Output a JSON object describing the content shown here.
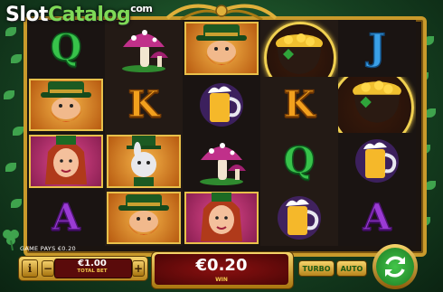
{
  "watermark": {
    "brand_a": "Slot",
    "brand_b": "Catalog",
    "suffix": "com"
  },
  "reels": [
    [
      "Q",
      "leprechaun",
      "elf-woman",
      "A"
    ],
    [
      "mushroom",
      "K",
      "rabbit",
      "leprechaun"
    ],
    [
      "leprechaun",
      "beer",
      "mushroom",
      "elf-woman"
    ],
    [
      "pot-of-gold",
      "K",
      "Q",
      "beer"
    ],
    [
      "J",
      "pot-of-gold",
      "beer",
      "A"
    ]
  ],
  "letters": {
    "Q": "Q",
    "K": "K",
    "J": "J",
    "A": "A"
  },
  "colors": {
    "Q": "#37c24a",
    "K": "#f2a01d",
    "J": "#3aa0e8",
    "A": "#9a3bd4",
    "frame": "#c99a2b",
    "win_bg": "#6a0a0a",
    "spin": "#2ea336"
  },
  "controls": {
    "info_label": "i",
    "minus_label": "−",
    "plus_label": "+",
    "game_pays": "GAME PAYS €0.20",
    "bet_value": "€1.00",
    "bet_label": "TOTAL BET",
    "win_value": "€0.20",
    "win_label": "WIN",
    "turbo_label": "TURBO",
    "auto_label": "AUTO"
  },
  "icons": {
    "spin": "refresh-arrows-icon",
    "info": "info-icon"
  }
}
